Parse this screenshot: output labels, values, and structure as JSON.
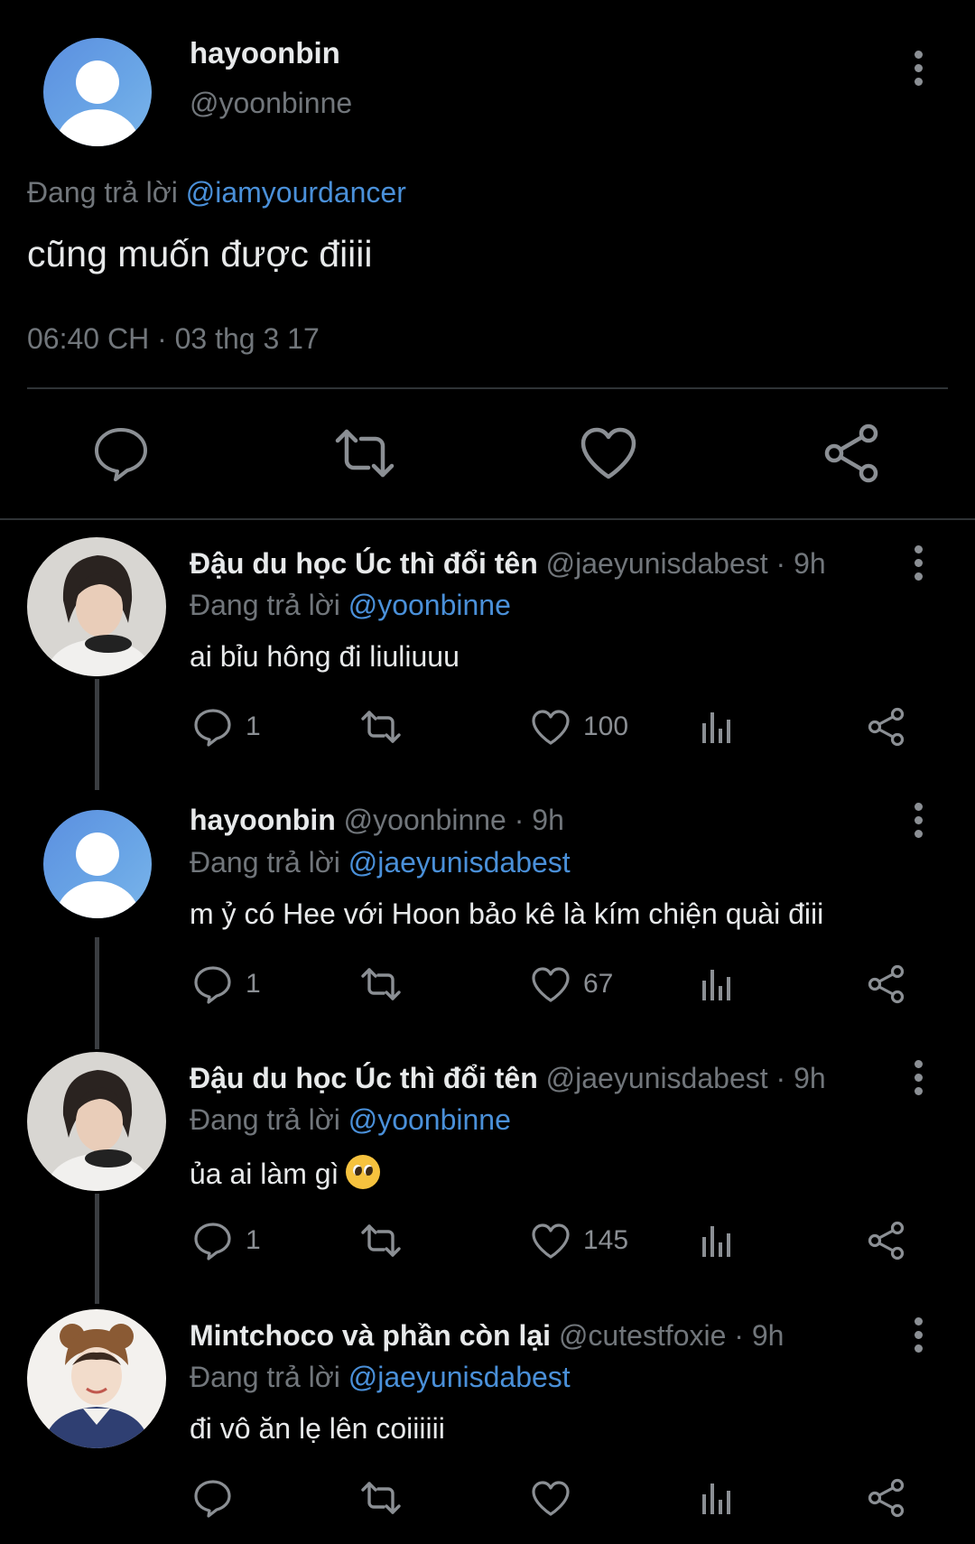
{
  "main_tweet": {
    "name": "hayoonbin",
    "handle": "@yoonbinne",
    "replying_prefix": "Đang trả lời",
    "replying_to": "@iamyourdancer",
    "text": "cũng muốn được điiii",
    "timestamp": "06:40 CH · 03 thg 3 17"
  },
  "replies": [
    {
      "name": "Đậu du học Úc thì đổi tên",
      "handle": "@jaeyunisdabest",
      "time": "· 9h",
      "replying_prefix": "Đang trả lời",
      "replying_to": "@yoonbinne",
      "text": "ai bỉu hông đi liuliuuu",
      "reply_count": "1",
      "like_count": "100"
    },
    {
      "name": "hayoonbin",
      "handle": "@yoonbinne",
      "time": "· 9h",
      "replying_prefix": "Đang trả lời",
      "replying_to": "@jaeyunisdabest",
      "text": "m ỷ có Hee với Hoon bảo kê là kím chiện quài điii",
      "reply_count": "1",
      "like_count": "67"
    },
    {
      "name": "Đậu du học Úc thì đổi tên",
      "handle": "@jaeyunisdabest",
      "time": "· 9h",
      "replying_prefix": "Đang trả lời",
      "replying_to": "@yoonbinne",
      "text": "ủa ai làm gì",
      "emoji": "pleading-face",
      "reply_count": "1",
      "like_count": "145"
    },
    {
      "name": "Mintchoco và phần còn lại",
      "handle": "@cutestfoxie",
      "time": "· 9h",
      "replying_prefix": "Đang trả lời",
      "replying_to": "@jaeyunisdabest",
      "text": "đi vô ăn lẹ lên coiiiiii",
      "reply_count": "",
      "like_count": ""
    }
  ],
  "colors": {
    "background": "#000000",
    "text": "#e7e9ea",
    "muted": "#71767b",
    "link": "#4a90d9",
    "divider": "#2f3336"
  },
  "icons": [
    "reply-icon",
    "retweet-icon",
    "like-icon",
    "share-icon",
    "analytics-icon",
    "more-icon"
  ]
}
